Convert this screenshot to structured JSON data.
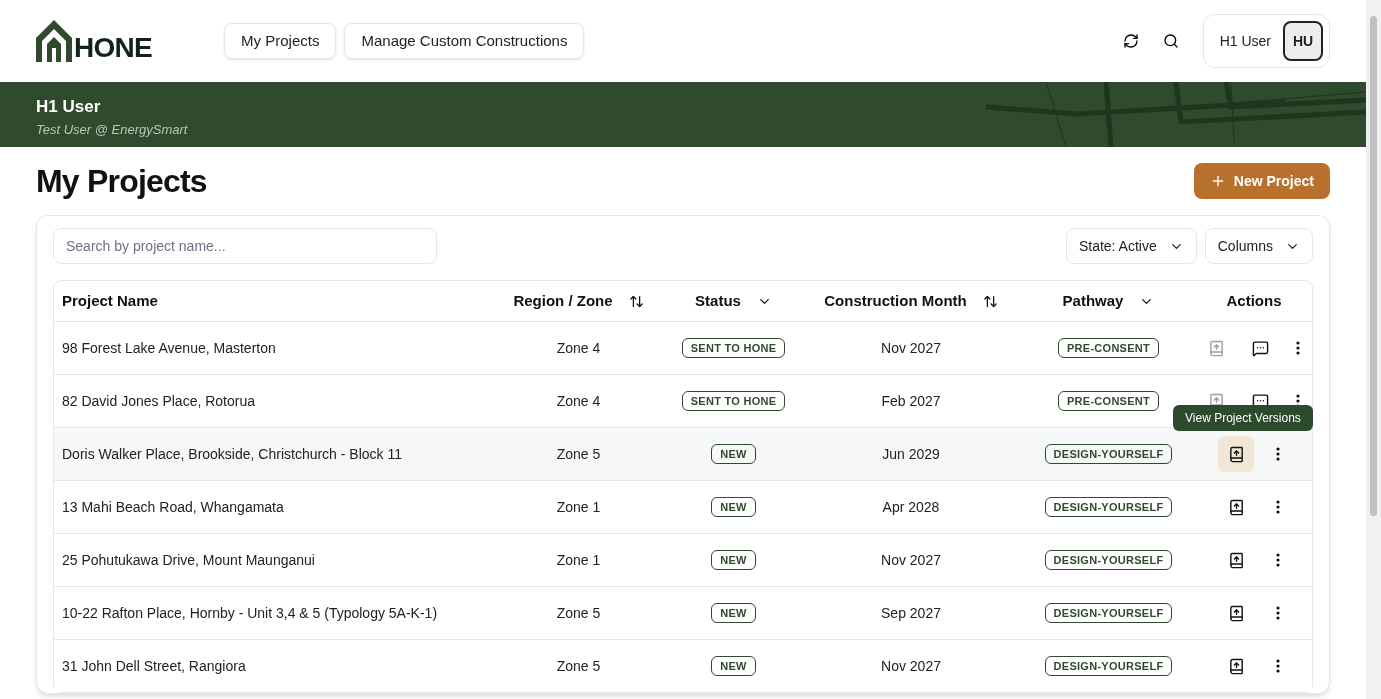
{
  "header": {
    "logo_text": "HONE",
    "nav": [
      {
        "label": "My Projects"
      },
      {
        "label": "Manage Custom Constructions"
      }
    ],
    "user_name": "H1 User",
    "avatar_initials": "HU"
  },
  "banner": {
    "name": "H1 User",
    "subtitle": "Test User @ EnergySmart"
  },
  "page_title": "My Projects",
  "new_project_button": "New Project",
  "search": {
    "placeholder": "Search by project name..."
  },
  "filters": [
    {
      "label": "State: Active"
    },
    {
      "label": "Columns"
    }
  ],
  "table": {
    "columns": [
      {
        "label": "Project Name",
        "sortable": false,
        "filterable": false
      },
      {
        "label": "Region / Zone",
        "sortable": true,
        "filterable": false
      },
      {
        "label": "Status",
        "sortable": false,
        "filterable": true
      },
      {
        "label": "Construction Month",
        "sortable": true,
        "filterable": false
      },
      {
        "label": "Pathway",
        "sortable": false,
        "filterable": true
      },
      {
        "label": "Actions",
        "sortable": false,
        "filterable": false
      }
    ],
    "rows": [
      {
        "name": "98 Forest Lake Avenue, Masterton",
        "zone": "Zone 4",
        "status": "SENT TO HONE",
        "month": "Nov 2027",
        "pathway": "PRE-CONSENT",
        "versions_enabled": false,
        "comments": true,
        "hovered": false
      },
      {
        "name": "82 David Jones Place, Rotorua",
        "zone": "Zone 4",
        "status": "SENT TO HONE",
        "month": "Feb 2027",
        "pathway": "PRE-CONSENT",
        "versions_enabled": false,
        "comments": true,
        "hovered": false
      },
      {
        "name": "Doris Walker Place, Brookside, Christchurch - Block 11",
        "zone": "Zone 5",
        "status": "NEW",
        "month": "Jun 2029",
        "pathway": "DESIGN-YOURSELF",
        "versions_enabled": true,
        "comments": false,
        "hovered": true
      },
      {
        "name": "13 Mahi Beach Road, Whangamata",
        "zone": "Zone 1",
        "status": "NEW",
        "month": "Apr 2028",
        "pathway": "DESIGN-YOURSELF",
        "versions_enabled": true,
        "comments": false,
        "hovered": false
      },
      {
        "name": "25 Pohutukawa Drive, Mount Maunganui",
        "zone": "Zone 1",
        "status": "NEW",
        "month": "Nov 2027",
        "pathway": "DESIGN-YOURSELF",
        "versions_enabled": true,
        "comments": false,
        "hovered": false
      },
      {
        "name": "10-22 Rafton Place, Hornby - Unit 3,4 & 5 (Typology 5A-K-1)",
        "zone": "Zone 5",
        "status": "NEW",
        "month": "Sep 2027",
        "pathway": "DESIGN-YOURSELF",
        "versions_enabled": true,
        "comments": false,
        "hovered": false
      },
      {
        "name": "31 John Dell Street, Rangiora",
        "zone": "Zone 5",
        "status": "NEW",
        "month": "Nov 2027",
        "pathway": "DESIGN-YOURSELF",
        "versions_enabled": true,
        "comments": false,
        "hovered": false
      }
    ]
  },
  "tooltip": "View Project Versions"
}
